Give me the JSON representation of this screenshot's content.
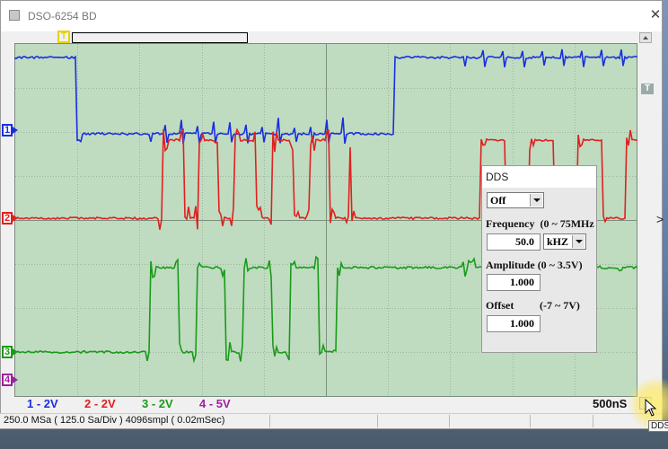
{
  "window": {
    "title": "DSO-6254 BD",
    "close_glyph": "✕"
  },
  "trigger": {
    "marker": "T",
    "level_marker": "T"
  },
  "channels": [
    {
      "marker": "1",
      "label": "1 - 2V",
      "color": "#1a2fe0"
    },
    {
      "marker": "2",
      "label": "2 - 2V",
      "color": "#e02020"
    },
    {
      "marker": "3",
      "label": "3 - 2V",
      "color": "#1a9a1a"
    },
    {
      "marker": "4",
      "label": "4 - 5V",
      "color": "#a020a0"
    }
  ],
  "timebase": "500nS",
  "expand_glyph": ">",
  "status": {
    "text": "250.0 MSa ( 125.0 Sa/Div ) 4096smpl ( 0.02mSec)"
  },
  "dds": {
    "title": "DDS",
    "mode": "Off",
    "frequency_label": "Frequency",
    "frequency_range": "(0 ~ 75MHz",
    "frequency_value": "50.0",
    "frequency_unit": "kHZ",
    "amplitude_label": "Amplitude",
    "amplitude_range": "(0 ~ 3.5V)",
    "amplitude_value": "1.000",
    "offset_label": "Offset",
    "offset_range": "(-7 ~ 7V)",
    "offset_value": "1.000"
  },
  "tooltip": "DDS"
}
